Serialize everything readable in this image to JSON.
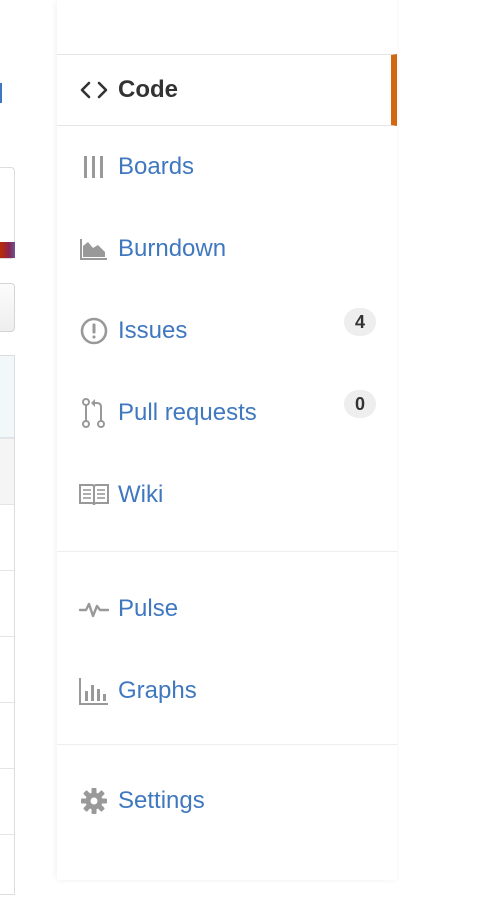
{
  "colors": {
    "link": "#4078c0",
    "selected_text": "#333333",
    "selected_accent": "#d26911",
    "icon": "#999999",
    "counter_bg": "#eeeeee"
  },
  "nav": {
    "primary": [
      {
        "label": "Code",
        "icon": "code-icon",
        "selected": true
      },
      {
        "label": "Boards",
        "icon": "boards-icon"
      },
      {
        "label": "Burndown",
        "icon": "burndown-icon"
      },
      {
        "label": "Issues",
        "icon": "issue-opened-icon",
        "count": "4"
      },
      {
        "label": "Pull requests",
        "icon": "git-pull-request-icon",
        "count": "0"
      },
      {
        "label": "Wiki",
        "icon": "book-icon"
      }
    ],
    "secondary": [
      {
        "label": "Pulse",
        "icon": "pulse-icon"
      },
      {
        "label": "Graphs",
        "icon": "graph-icon"
      }
    ],
    "tertiary": [
      {
        "label": "Settings",
        "icon": "gear-icon"
      }
    ]
  }
}
